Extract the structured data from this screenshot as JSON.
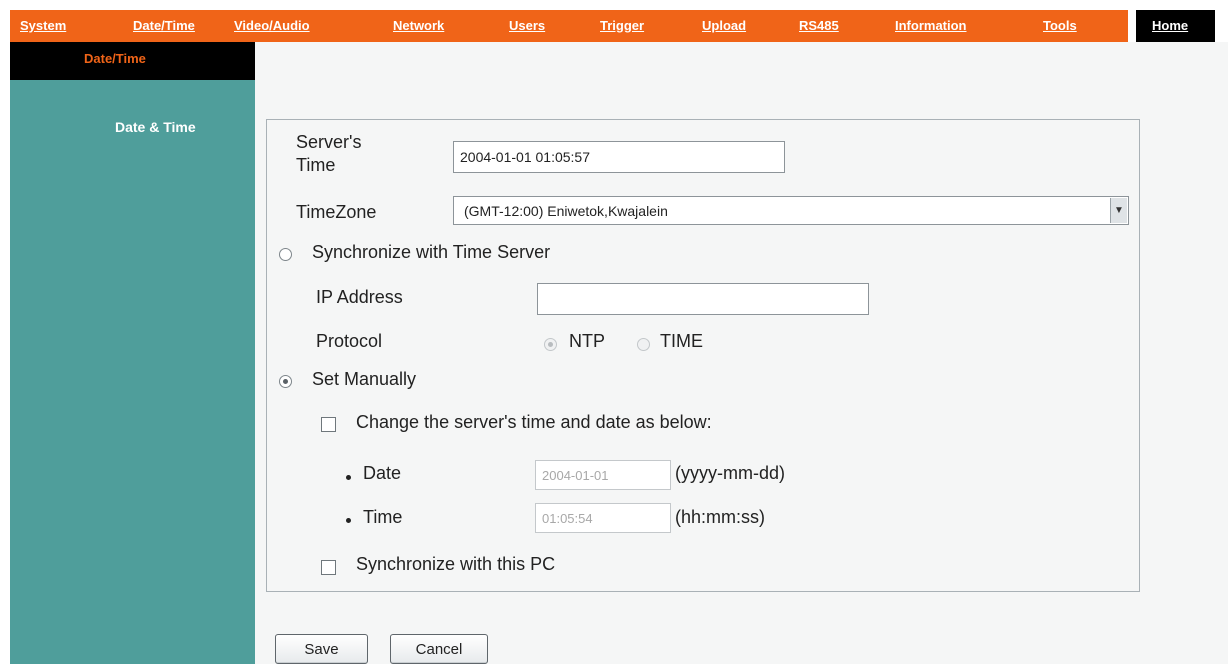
{
  "nav": {
    "items": [
      "System",
      "Date/Time",
      "Video/Audio",
      "Network",
      "Users",
      "Trigger",
      "Upload",
      "RS485",
      "Information",
      "Tools"
    ],
    "home": "Home"
  },
  "sidebar": {
    "header": "Date/Time",
    "items": [
      "Date & Time"
    ]
  },
  "form": {
    "server_time_label": "Server's Time",
    "server_time_value": "2004-01-01 01:05:57",
    "timezone_label": "TimeZone",
    "timezone_value": "(GMT-12:00) Eniwetok,Kwajalein",
    "sync_time_server_label": "Synchronize with Time Server",
    "ip_address_label": "IP Address",
    "ip_address_value": "",
    "protocol_label": "Protocol",
    "protocol_options": [
      "NTP",
      "TIME"
    ],
    "protocol_selected": "NTP",
    "set_manually_label": "Set Manually",
    "time_mode_selected": "Set Manually",
    "change_time_label": "Change the server's time and date as below:",
    "change_time_checked": false,
    "date_label": "Date",
    "date_value": "2004-01-01",
    "date_format": "(yyyy-mm-dd)",
    "time_label": "Time",
    "time_value": "01:05:54",
    "time_format": "(hh:mm:ss)",
    "sync_pc_label": "Synchronize with this PC",
    "sync_pc_checked": false
  },
  "buttons": {
    "save": "Save",
    "cancel": "Cancel"
  },
  "colors": {
    "nav_bg": "#f06418",
    "sidebar_bg": "#4f9e9b",
    "sidebar_header_fg": "#f06418",
    "main_bg": "#f5f6f6"
  }
}
